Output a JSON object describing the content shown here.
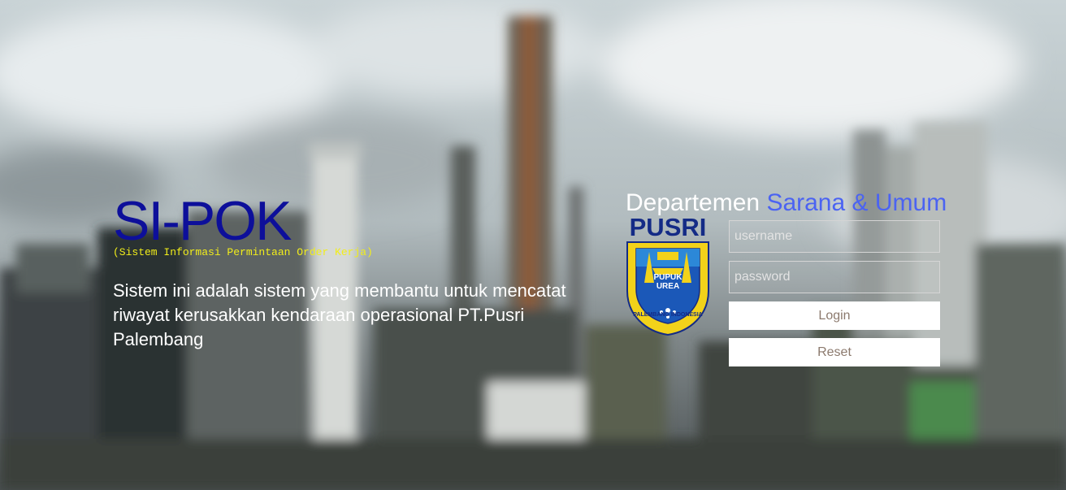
{
  "brand": {
    "title": "SI-POK",
    "subtitle": "(Sistem Informasi Permintaan Order Kerja)",
    "description": "Sistem ini adalah sistem yang membantu untuk mencatat riwayat kerusakkan kendaraan operasional PT.Pusri Palembang"
  },
  "department": {
    "word1": "Departemen",
    "word2": "Sarana & Umum"
  },
  "logo": {
    "name": "PUSRI",
    "shield_line1": "PUPUK",
    "shield_line2": "UREA",
    "ring_text": "PALEMBANG INDONESIA"
  },
  "login": {
    "username_placeholder": "username",
    "password_placeholder": "password",
    "login_label": "Login",
    "reset_label": "Reset"
  },
  "colors": {
    "title": "#0d0f9a",
    "subtitle": "#f2ee1a",
    "accent": "#4b63f2",
    "button_text": "#8c7a6e"
  },
  "background": {
    "image": "blurred industrial plant with towers and cloudy sky"
  }
}
